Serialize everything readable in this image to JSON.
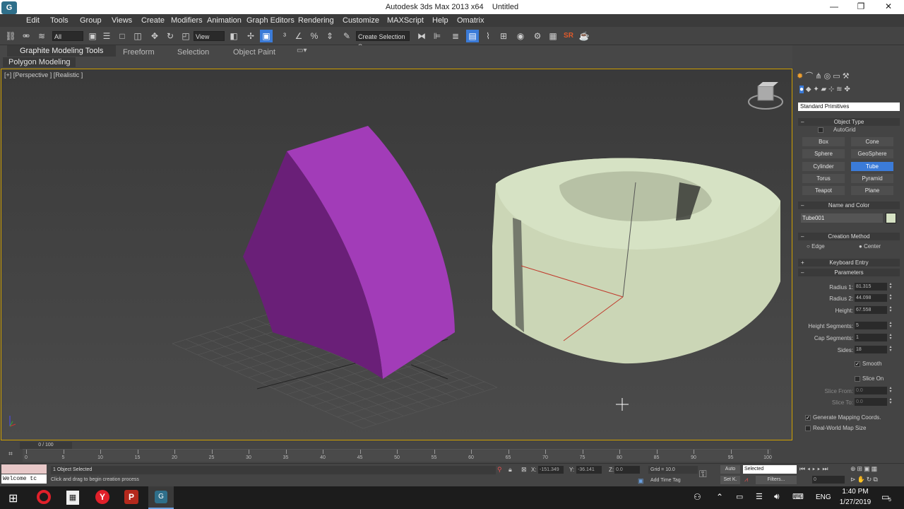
{
  "window": {
    "title": "Autodesk 3ds Max  2013 x64",
    "file": "Untitled",
    "logo": "G",
    "controls": {
      "minimize": "—",
      "maximize": "❐",
      "close": "✕"
    }
  },
  "menu": [
    "Edit",
    "Tools",
    "Group",
    "Views",
    "Create",
    "Modifiers",
    "Animation",
    "Graph Editors",
    "Rendering",
    "Customize",
    "MAXScript",
    "Help",
    "Omatrix"
  ],
  "toolbar": {
    "filter_select": "All",
    "view_select": "View",
    "selection_set": "Create Selection S",
    "srtext": "SR"
  },
  "ribbon": {
    "tabs": [
      "Graphite Modeling Tools",
      "Freeform",
      "Selection",
      "Object Paint"
    ],
    "subtab": "Polygon Modeling"
  },
  "viewport": {
    "label": "[+] [Perspective ] [Realistic ]",
    "colors": {
      "wedge": "#a23cb8",
      "wedge_side": "#6a1f78",
      "tube": "#d6e2c4",
      "border": "#d0a000"
    }
  },
  "command_panel": {
    "category": "Standard Primitives",
    "object_type": {
      "header": "Object Type",
      "autogrid": "AutoGrid",
      "buttons": [
        "Box",
        "Cone",
        "Sphere",
        "GeoSphere",
        "Cylinder",
        "Tube",
        "Torus",
        "Pyramid",
        "Teapot",
        "Plane"
      ],
      "active": "Tube"
    },
    "name_color": {
      "header": "Name and Color",
      "name": "Tube001",
      "color": "#d6e2c4"
    },
    "creation_method": {
      "header": "Creation Method",
      "options": [
        "Edge",
        "Center"
      ],
      "selected": "Center"
    },
    "keyboard_entry": {
      "header": "Keyboard Entry"
    },
    "parameters": {
      "header": "Parameters",
      "radius1_label": "Radius 1:",
      "radius1": "81.315",
      "radius2_label": "Radius 2:",
      "radius2": "44.098",
      "height_label": "Height:",
      "height": "67.558",
      "height_segments_label": "Height Segments:",
      "height_segments": "5",
      "cap_segments_label": "Cap Segments:",
      "cap_segments": "1",
      "sides_label": "Sides:",
      "sides": "18",
      "smooth_label": "Smooth",
      "slice_on_label": "Slice On",
      "slice_from_label": "Slice From:",
      "slice_from": "0.0",
      "slice_to_label": "Slice To:",
      "slice_to": "0.0",
      "gen_mapping_label": "Generate Mapping Coords.",
      "real_world_label": "Real-World Map Size"
    }
  },
  "timeline": {
    "frame": "0 / 100",
    "ticks": [
      "0",
      "5",
      "10",
      "15",
      "20",
      "25",
      "30",
      "35",
      "40",
      "45",
      "50",
      "55",
      "60",
      "65",
      "70",
      "75",
      "80",
      "85",
      "90",
      "95",
      "100"
    ]
  },
  "status": {
    "listener": "Welcome tc",
    "selected": "1 Object Selected",
    "prompt": "Click and drag to begin creation process",
    "x_label": "X:",
    "x": "-151.349",
    "y_label": "Y:",
    "y": "-36.141",
    "z_label": "Z:",
    "z": "0.0",
    "grid": "Grid = 10.0",
    "add_time_tag": "Add Time Tag",
    "auto": "Auto",
    "setk": "Set K.",
    "selected_dropdown": "Selected",
    "filters": "Filters...",
    "frame_field": "0"
  },
  "taskbar": {
    "time": "1:40 PM",
    "date": "1/27/2019",
    "lang": "ENG",
    "notif": "5"
  }
}
